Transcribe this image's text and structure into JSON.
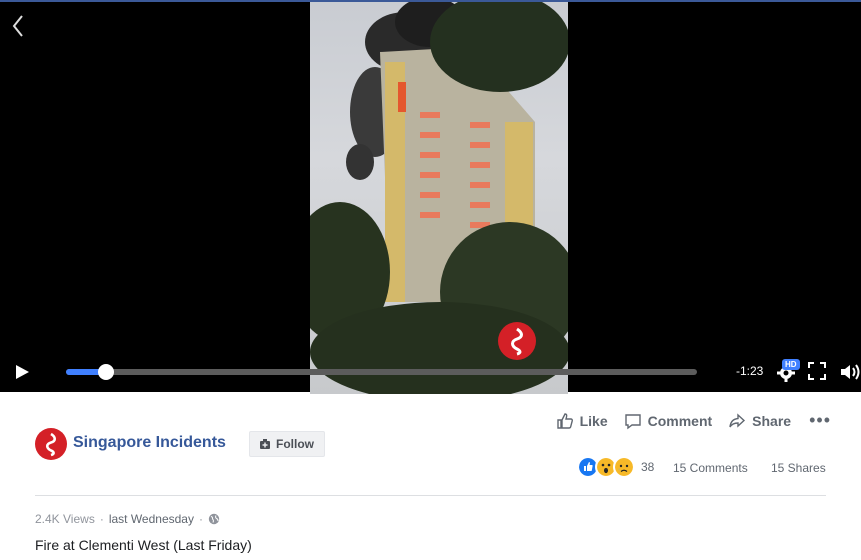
{
  "player": {
    "time_remaining": "-1:23",
    "progress": 0.063,
    "buffered": 1.0,
    "quality_badge": "HD"
  },
  "post": {
    "page_name": "Singapore Incidents",
    "follow_label": "Follow",
    "actions": {
      "like": "Like",
      "comment": "Comment",
      "share": "Share",
      "more": "•••"
    },
    "reactions": {
      "types": [
        "like",
        "wow",
        "sad"
      ],
      "count": "38"
    },
    "comments_count": "15 Comments",
    "shares_count": "15 Shares",
    "views": "2.4K Views",
    "separator": "·",
    "time": "last Wednesday",
    "caption": "Fire at Clementi West (Last Friday)"
  },
  "colors": {
    "accent": "#4080ff",
    "brand": "#365899",
    "page_logo": "#d42027"
  }
}
